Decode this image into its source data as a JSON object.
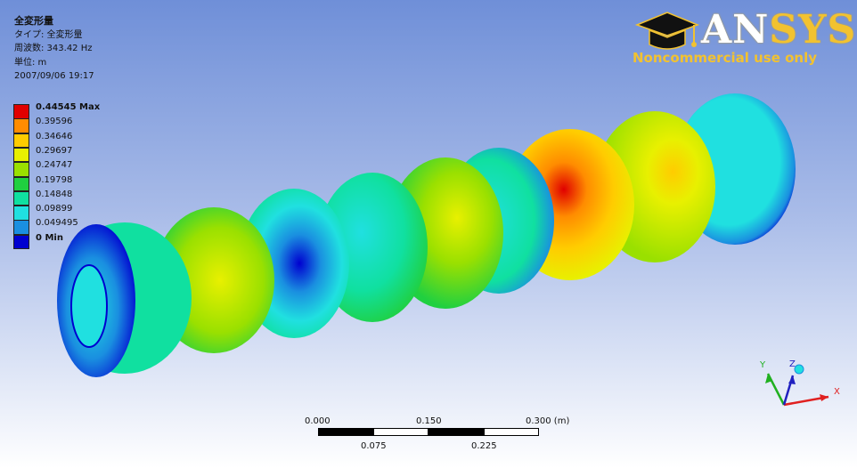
{
  "result": {
    "title": "全変形量",
    "type_line": "タイプ: 全変形量",
    "frequency_line": "周波数: 343.42  Hz",
    "unit_line": "単位: m",
    "datetime": "2007/09/06 19:17"
  },
  "legend": {
    "entries": [
      {
        "label": "0.44545 Max",
        "color": "#e00000",
        "bold": true
      },
      {
        "label": "0.39596",
        "color": "#ff8c00",
        "bold": false
      },
      {
        "label": "0.34646",
        "color": "#ffcc00",
        "bold": false
      },
      {
        "label": "0.29697",
        "color": "#e8f000",
        "bold": false
      },
      {
        "label": "0.24747",
        "color": "#9ae000",
        "bold": false
      },
      {
        "label": "0.19798",
        "color": "#20d040",
        "bold": false
      },
      {
        "label": "0.14848",
        "color": "#10e0a0",
        "bold": false
      },
      {
        "label": "0.09899",
        "color": "#20e0e0",
        "bold": false
      },
      {
        "label": "0.049495",
        "color": "#1a8fe0",
        "bold": false
      },
      {
        "label": "0 Min",
        "color": "#0000d0",
        "bold": true
      }
    ]
  },
  "logo": {
    "brand_an": "AN",
    "brand_sys": "SYS",
    "subtitle": "Noncommercial use only"
  },
  "scale_bar": {
    "top_ticks": [
      "0.000",
      "0.150",
      "0.300 (m)"
    ],
    "bottom_ticks": [
      "0.075",
      "0.225"
    ]
  },
  "triad": {
    "x_label": "X",
    "y_label": "Y",
    "z_label": "Z"
  },
  "colors": {
    "max_red": "#e00000",
    "min_blue": "#0000d0",
    "logo_gold": "#f2c230"
  }
}
